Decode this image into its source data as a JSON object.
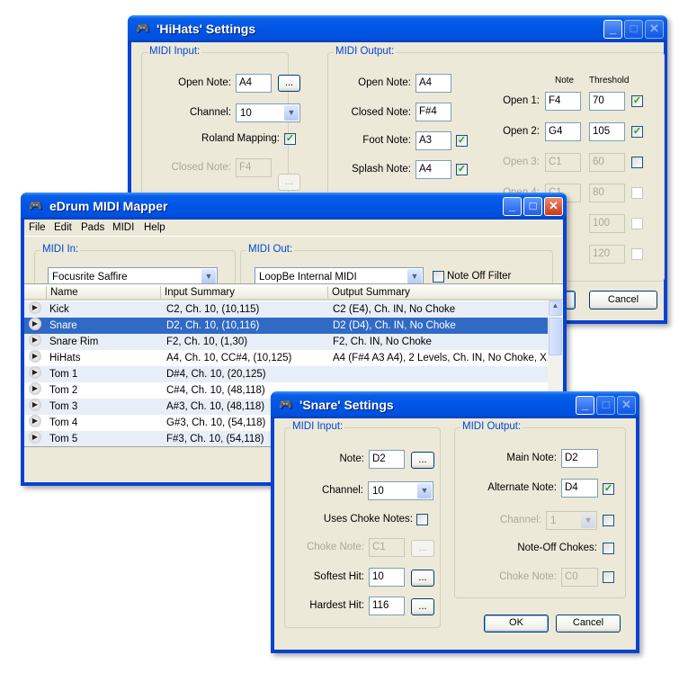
{
  "hihats": {
    "title": "'HiHats' Settings",
    "input": {
      "legend": "MIDI Input:",
      "open_note_label": "Open Note:",
      "open_note": "A4",
      "browse": "...",
      "channel_label": "Channel:",
      "channel": "10",
      "roland_label": "Roland Mapping:",
      "roland_checked": true,
      "closed_note_label": "Closed Note:",
      "closed_note": "F4"
    },
    "output": {
      "legend": "MIDI Output:",
      "open_note_label": "Open Note:",
      "open_note": "A4",
      "closed_note_label": "Closed Note:",
      "closed_note": "F#4",
      "foot_note_label": "Foot Note:",
      "foot_note": "A3",
      "splash_note_label": "Splash Note:",
      "splash_note": "A4",
      "note_header": "Note",
      "threshold_header": "Threshold",
      "levels": [
        {
          "label": "Open 1:",
          "note": "F4",
          "threshold": "70"
        },
        {
          "label": "Open 2:",
          "note": "G4",
          "threshold": "105"
        },
        {
          "label": "Open 3:",
          "note": "C1",
          "threshold": "60"
        },
        {
          "label": "Open 4:",
          "note": "C1",
          "threshold": "80"
        },
        {
          "threshold": "100"
        },
        {
          "threshold": "120"
        }
      ]
    },
    "cancel": "Cancel"
  },
  "mapper": {
    "title": "eDrum MIDI Mapper",
    "menu": [
      "File",
      "Edit",
      "Pads",
      "MIDI",
      "Help"
    ],
    "midi_in": {
      "legend": "MIDI In:",
      "device": "Focusrite Saffire"
    },
    "midi_out": {
      "legend": "MIDI Out:",
      "device": "LoopBe Internal MIDI",
      "note_off_filter": "Note Off Filter"
    },
    "columns": [
      "Name",
      "Input Summary",
      "Output Summary"
    ],
    "rows": [
      {
        "name": "Kick",
        "input": "C2, Ch. 10, (10,115)",
        "output": "C2 (E4), Ch. IN, No Choke"
      },
      {
        "name": "Snare",
        "input": "D2, Ch. 10, (10,116)",
        "output": "D2 (D4), Ch. IN, No Choke"
      },
      {
        "name": "Snare Rim",
        "input": "F2, Ch. 10, (1,30)",
        "output": "F2, Ch. IN, No Choke"
      },
      {
        "name": "HiHats",
        "input": "A4, Ch. 10, CC#4, (10,125)",
        "output": "A4 (F#4 A3 A4), 2 Levels, Ch. IN, No Choke, X..."
      },
      {
        "name": "Tom 1",
        "input": "D#4, Ch. 10, (20,125)"
      },
      {
        "name": "Tom 2",
        "input": "C#4, Ch. 10, (48,118)"
      },
      {
        "name": "Tom 3",
        "input": "A#3, Ch. 10, (48,118)"
      },
      {
        "name": "Tom 4",
        "input": "G#3, Ch. 10, (54,118)"
      },
      {
        "name": "Tom 5",
        "input": "F#3, Ch. 10, (54,118)"
      }
    ]
  },
  "snare": {
    "title": "'Snare' Settings",
    "input": {
      "legend": "MIDI Input:",
      "note_label": "Note:",
      "note": "D2",
      "browse": "...",
      "channel_label": "Channel:",
      "channel": "10",
      "uses_choke_label": "Uses Choke Notes:",
      "choke_note_label": "Choke Note:",
      "choke_note": "C1",
      "softest_label": "Softest Hit:",
      "softest": "10",
      "hardest_label": "Hardest Hit:",
      "hardest": "116"
    },
    "output": {
      "legend": "MIDI Output:",
      "main_note_label": "Main Note:",
      "main_note": "D2",
      "alt_note_label": "Alternate Note:",
      "alt_note": "D4",
      "channel_label": "Channel:",
      "channel": "1",
      "note_off_label": "Note-Off Chokes:",
      "choke_note_label": "Choke Note:",
      "choke_note": "C0"
    },
    "ok": "OK",
    "cancel": "Cancel"
  }
}
